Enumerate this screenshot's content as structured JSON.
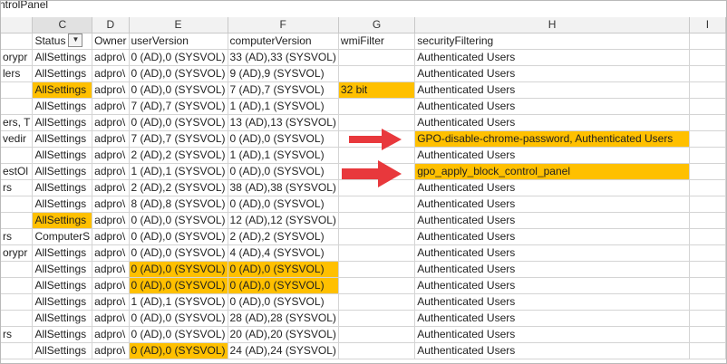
{
  "formula_bar_text": "ntrolPanel",
  "column_letters": [
    "C",
    "D",
    "E",
    "F",
    "G",
    "H",
    "I"
  ],
  "header": {
    "a": "",
    "status": "Status",
    "filter_glyph": "▼",
    "owner": "Owner",
    "userVersion": "userVersion",
    "computerVersion": "computerVersion",
    "wmiFilter": "wmiFilter",
    "securityFiltering": "securityFiltering"
  },
  "rows": [
    {
      "a": "orypr",
      "c": "AllSettings",
      "d": "adpro\\",
      "e": "0 (AD),0 (SYSVOL)",
      "f": "33 (AD),33 (SYSVOL)",
      "g": "",
      "h": "Authenticated Users"
    },
    {
      "a": "lers",
      "c": "AllSettings",
      "d": "adpro\\",
      "e": "0 (AD),0 (SYSVOL)",
      "f": "9 (AD),9 (SYSVOL)",
      "g": "",
      "h": "Authenticated Users"
    },
    {
      "a": "",
      "c": "AllSettings",
      "d": "adpro\\",
      "e": "0 (AD),0 (SYSVOL)",
      "f": "7 (AD),7 (SYSVOL)",
      "g": "32 bit",
      "h": "Authenticated Users"
    },
    {
      "a": "",
      "c": "AllSettings",
      "d": "adpro\\",
      "e": "7 (AD),7 (SYSVOL)",
      "f": "1 (AD),1 (SYSVOL)",
      "g": "",
      "h": "Authenticated Users"
    },
    {
      "a": "ers, T",
      "c": "AllSettings",
      "d": "adpro\\",
      "e": "0 (AD),0 (SYSVOL)",
      "f": "13 (AD),13 (SYSVOL)",
      "g": "",
      "h": "Authenticated Users"
    },
    {
      "a": "vedir",
      "c": "AllSettings",
      "d": "adpro\\",
      "e": "7 (AD),7 (SYSVOL)",
      "f": "0 (AD),0 (SYSVOL)",
      "g": "",
      "h": "GPO-disable-chrome-password, Authenticated Users"
    },
    {
      "a": "",
      "c": "AllSettings",
      "d": "adpro\\",
      "e": "2 (AD),2 (SYSVOL)",
      "f": "1 (AD),1 (SYSVOL)",
      "g": "",
      "h": "Authenticated Users"
    },
    {
      "a": "estOl",
      "c": "AllSettings",
      "d": "adpro\\",
      "e": "1 (AD),1 (SYSVOL)",
      "f": "0 (AD),0 (SYSVOL)",
      "g": "",
      "h": "gpo_apply_block_control_panel"
    },
    {
      "a": "rs",
      "c": "AllSettings",
      "d": "adpro\\",
      "e": "2 (AD),2 (SYSVOL)",
      "f": "38 (AD),38 (SYSVOL)",
      "g": "",
      "h": "Authenticated Users"
    },
    {
      "a": "",
      "c": "AllSettings",
      "d": "adpro\\",
      "e": "8 (AD),8 (SYSVOL)",
      "f": "0 (AD),0 (SYSVOL)",
      "g": "",
      "h": "Authenticated Users"
    },
    {
      "a": "",
      "c": "AllSettings",
      "d": "adpro\\",
      "e": "0 (AD),0 (SYSVOL)",
      "f": "12 (AD),12 (SYSVOL)",
      "g": "",
      "h": "Authenticated Users"
    },
    {
      "a": "rs",
      "c": "ComputerS",
      "d": "adpro\\",
      "e": "0 (AD),0 (SYSVOL)",
      "f": "2 (AD),2 (SYSVOL)",
      "g": "",
      "h": "Authenticated Users"
    },
    {
      "a": "orypr",
      "c": "AllSettings",
      "d": "adpro\\",
      "e": "0 (AD),0 (SYSVOL)",
      "f": "4 (AD),4 (SYSVOL)",
      "g": "",
      "h": "Authenticated Users"
    },
    {
      "a": "",
      "c": "AllSettings",
      "d": "adpro\\",
      "e": "0 (AD),0 (SYSVOL)",
      "f": "0 (AD),0 (SYSVOL)",
      "g": "",
      "h": "Authenticated Users"
    },
    {
      "a": "",
      "c": "AllSettings",
      "d": "adpro\\",
      "e": "0 (AD),0 (SYSVOL)",
      "f": "0 (AD),0 (SYSVOL)",
      "g": "",
      "h": "Authenticated Users"
    },
    {
      "a": "",
      "c": "AllSettings",
      "d": "adpro\\",
      "e": "1 (AD),1 (SYSVOL)",
      "f": "0 (AD),0 (SYSVOL)",
      "g": "",
      "h": "Authenticated Users"
    },
    {
      "a": "",
      "c": "AllSettings",
      "d": "adpro\\",
      "e": "0 (AD),0 (SYSVOL)",
      "f": "28 (AD),28 (SYSVOL)",
      "g": "",
      "h": "Authenticated Users"
    },
    {
      "a": "rs",
      "c": "AllSettings",
      "d": "adpro\\",
      "e": "0 (AD),0 (SYSVOL)",
      "f": "20 (AD),20 (SYSVOL)",
      "g": "",
      "h": "Authenticated Users"
    },
    {
      "a": "",
      "c": "AllSettings",
      "d": "adpro\\",
      "e": "0 (AD),0 (SYSVOL)",
      "f": "24 (AD),24 (SYSVOL)",
      "g": "",
      "h": "Authenticated Users"
    }
  ],
  "highlight_color": "#ffc000",
  "arrow_color": "#e8383c"
}
